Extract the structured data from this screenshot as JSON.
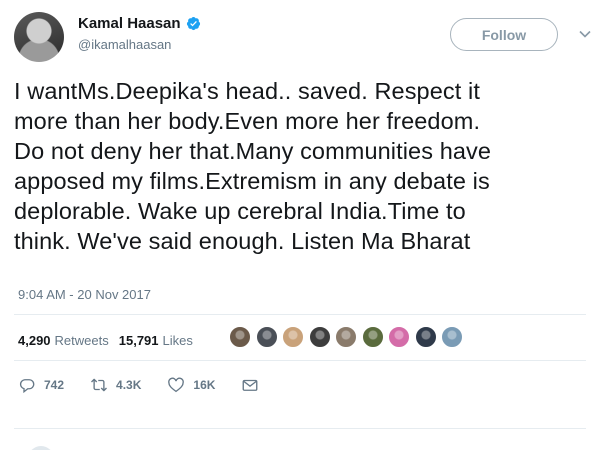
{
  "user": {
    "name": "Kamal Haasan",
    "handle": "@ikamalhaasan"
  },
  "follow_label": "Follow",
  "tweet_lines": [
    "I wantMs.Deepika's head.. saved. Respect it",
    "more than her body.Even more her freedom.",
    "Do not deny her that.Many communities have",
    "apposed my films.Extremism in any debate is",
    "deplorable. Wake up cerebral India.Time to",
    "think. We've said enough. Listen Ma Bharat"
  ],
  "timestamp": "9:04 AM - 20 Nov 2017",
  "stats": {
    "retweets_count": "4,290",
    "retweets_label": "Retweets",
    "likes_count": "15,791",
    "likes_label": "Likes"
  },
  "liker_colors": [
    "#6b5a4a",
    "#4a4f57",
    "#c9a27a",
    "#3d3d3d",
    "#8a7b6b",
    "#5a6b3d",
    "#d46ca8",
    "#2f3a4a",
    "#7a9bb5"
  ],
  "actions": {
    "reply_count": "742",
    "retweet_count": "4.3K",
    "like_count": "16K"
  },
  "colors": {
    "text": "#14171a",
    "secondary": "#657786",
    "verified": "#1da1f2",
    "border": "#e6ecf0"
  }
}
